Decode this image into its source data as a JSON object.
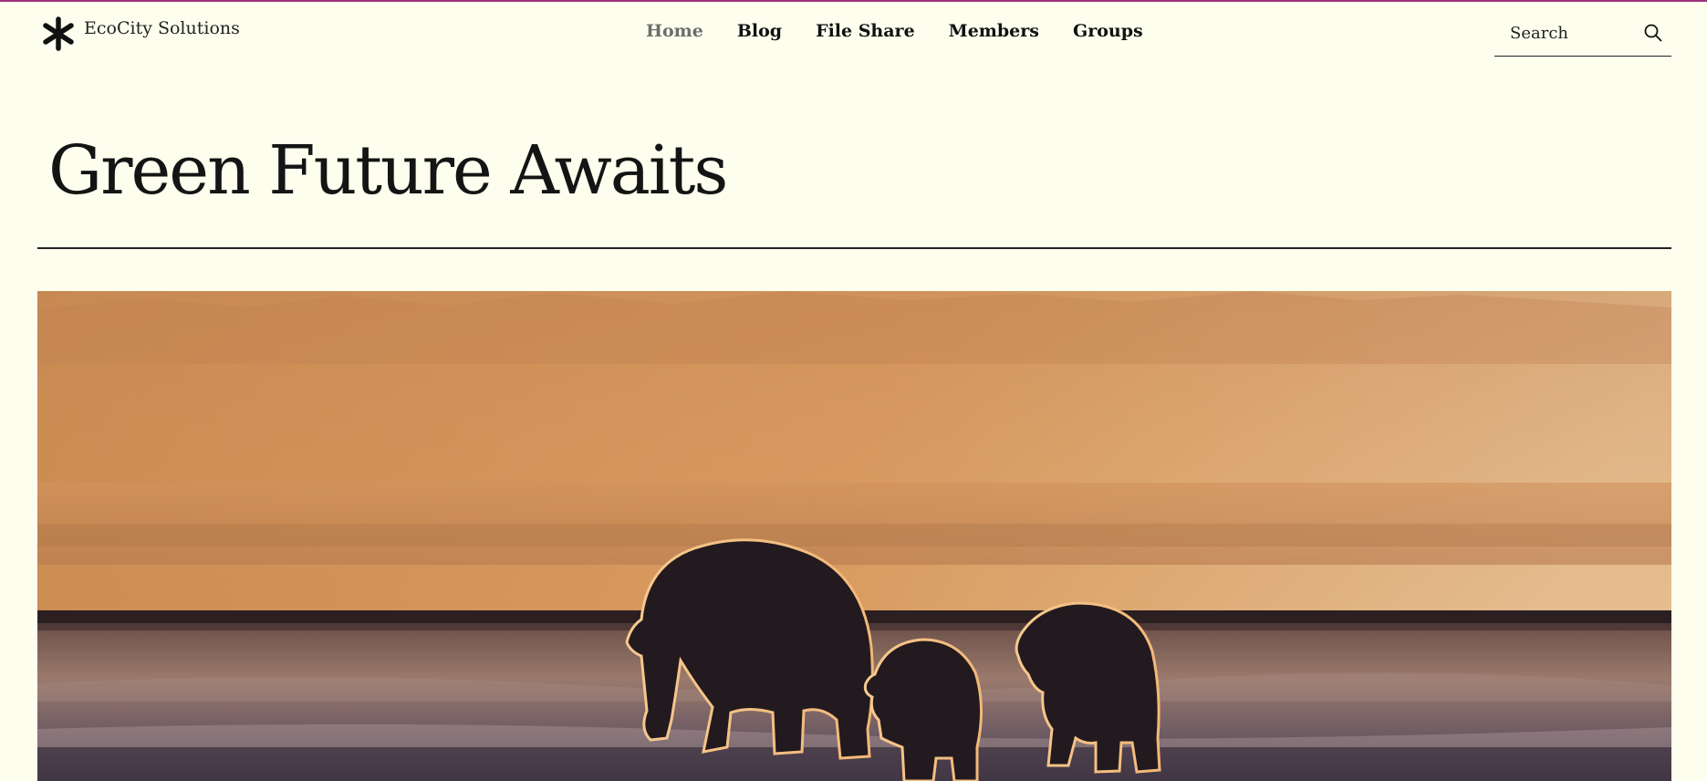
{
  "site": {
    "brand_name": "EcoCity Solutions",
    "logo_icon": "asterisk-icon"
  },
  "nav": {
    "items": [
      {
        "label": "Home",
        "active": true
      },
      {
        "label": "Blog",
        "active": false
      },
      {
        "label": "File Share",
        "active": false
      },
      {
        "label": "Members",
        "active": false
      },
      {
        "label": "Groups",
        "active": false
      }
    ]
  },
  "search": {
    "placeholder": "Search",
    "icon": "search-icon"
  },
  "main": {
    "title": "Green Future Awaits"
  },
  "hero": {
    "description": "polar-bears-sunset-photo"
  },
  "colors": {
    "background": "#fdfeee",
    "text": "#111111",
    "nav_active": "#6d6d6d",
    "accent_bar": "#a0307a"
  }
}
